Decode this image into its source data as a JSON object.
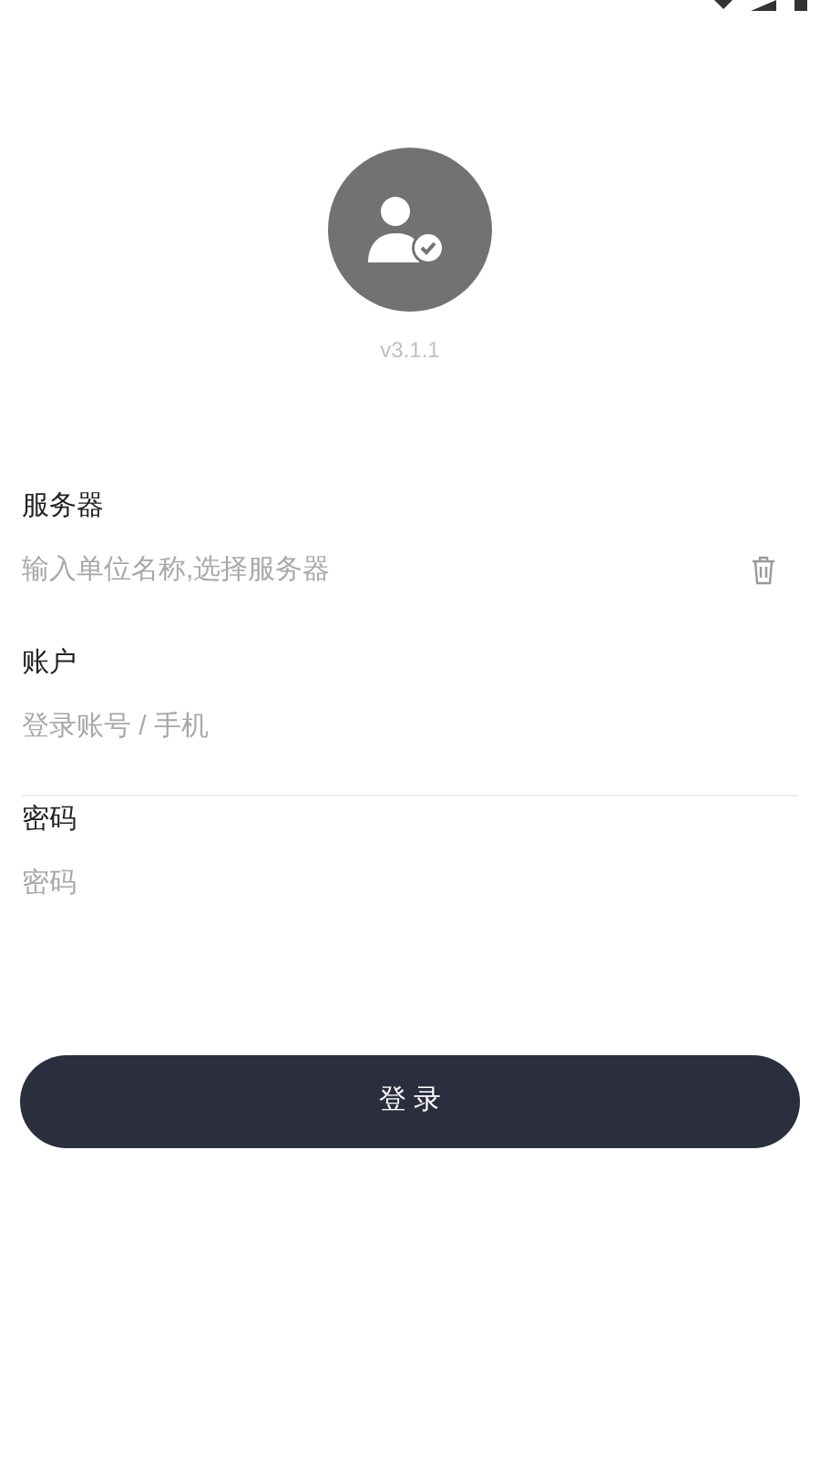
{
  "version": "v3.1.1",
  "fields": [
    {
      "label": "服务器",
      "placeholder": "输入单位名称,选择服务器",
      "clear_button": true,
      "underline": false
    },
    {
      "label": "账户",
      "placeholder": "登录账号 / 手机",
      "clear_button": false,
      "underline": true
    },
    {
      "label": "密码",
      "placeholder": "密码",
      "clear_button": false,
      "underline": false
    }
  ],
  "login_button": "登 录"
}
